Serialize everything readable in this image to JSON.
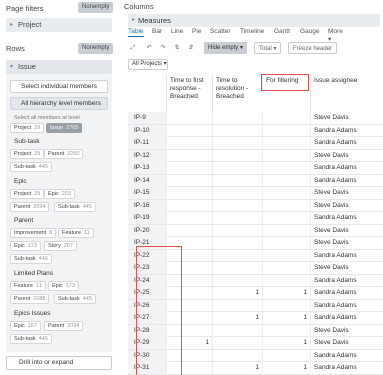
{
  "page_filters": {
    "label": "Page filters",
    "pill": "Nonempty",
    "dimension": "Project"
  },
  "rows_section": {
    "label": "Rows",
    "pill": "Nonempty",
    "dimension": "Issue"
  },
  "issue_panel": {
    "select_individual": "Select individual members",
    "all_hierarchy": "All hierarchy level members",
    "select_all_note": "Select all members at level",
    "top_chips": [
      {
        "label": "Project",
        "n": "29",
        "on": false
      },
      {
        "label": "Issue",
        "n": "2705",
        "on": true
      }
    ],
    "groups": [
      {
        "title": "Sub-task",
        "chips": [
          {
            "label": "Project",
            "n": "29"
          },
          {
            "label": "Parent",
            "n": "2260"
          },
          {
            "label": "Sub-task",
            "n": "445"
          }
        ]
      },
      {
        "title": "Epic",
        "chips": [
          {
            "label": "Project",
            "n": "29"
          },
          {
            "label": "Epic",
            "n": "203"
          },
          {
            "label": "Parent",
            "n": "2094"
          },
          {
            "label": "Sub-task",
            "n": "445"
          }
        ]
      },
      {
        "title": "Parent",
        "chips": [
          {
            "label": "Improvement",
            "n": "8"
          },
          {
            "label": "Feature",
            "n": "11"
          },
          {
            "label": "Epic",
            "n": "173"
          },
          {
            "label": "Story",
            "n": "207"
          },
          {
            "label": "Sub-task",
            "n": "446"
          }
        ]
      },
      {
        "title": "Limited Plans",
        "chips": [
          {
            "label": "Feature",
            "n": "11"
          },
          {
            "label": "Epic",
            "n": "173"
          },
          {
            "label": "Parent",
            "n": "2088"
          },
          {
            "label": "Sub-task",
            "n": "445"
          }
        ]
      },
      {
        "title": "Epics Issues",
        "chips": [
          {
            "label": "Epic",
            "n": "167"
          },
          {
            "label": "Parent",
            "n": "2094"
          },
          {
            "label": "Sub-task",
            "n": "445"
          }
        ]
      }
    ],
    "drill": "Drill into or expand"
  },
  "columns": {
    "label": "Columns",
    "dimension": "Measures"
  },
  "tabs": [
    "Table",
    "Bar",
    "Line",
    "Pie",
    "Scatter",
    "Timeline",
    "Gantt",
    "Gauge",
    "More"
  ],
  "selected_tab": "Table",
  "toolbar": {
    "hide_empty": "Hide empty",
    "total": "Total",
    "freeze": "Freeze header"
  },
  "project_filter": "All Projects",
  "table": {
    "headers": [
      "Time to first response - Breached",
      "Time to resolution - Breached",
      "For filtering",
      "Issue assignee"
    ],
    "rows": [
      {
        "key": "IP-9",
        "c1": "",
        "c2": "",
        "c3": "",
        "assignee": "Steve Davis"
      },
      {
        "key": "IP-10",
        "c1": "",
        "c2": "",
        "c3": "",
        "assignee": "Sandra Adams"
      },
      {
        "key": "IP-11",
        "c1": "",
        "c2": "",
        "c3": "",
        "assignee": "Sandra Adams"
      },
      {
        "key": "IP-12",
        "c1": "",
        "c2": "",
        "c3": "",
        "assignee": "Steve Davis"
      },
      {
        "key": "IP-13",
        "c1": "",
        "c2": "",
        "c3": "",
        "assignee": "Sandra Adams"
      },
      {
        "key": "IP-14",
        "c1": "",
        "c2": "",
        "c3": "",
        "assignee": "Sandra Adams"
      },
      {
        "key": "IP-15",
        "c1": "",
        "c2": "",
        "c3": "",
        "assignee": "Steve Davis"
      },
      {
        "key": "IP-16",
        "c1": "",
        "c2": "",
        "c3": "",
        "assignee": "Steve Davis"
      },
      {
        "key": "IP-19",
        "c1": "",
        "c2": "",
        "c3": "",
        "assignee": "Sandra Adams"
      },
      {
        "key": "IP-20",
        "c1": "",
        "c2": "",
        "c3": "",
        "assignee": "Steve Davis"
      },
      {
        "key": "IP-21",
        "c1": "",
        "c2": "",
        "c3": "",
        "assignee": "Steve Davis"
      },
      {
        "key": "IP-22",
        "c1": "",
        "c2": "",
        "c3": "",
        "assignee": "Sandra Adams"
      },
      {
        "key": "IP-23",
        "c1": "",
        "c2": "",
        "c3": "",
        "assignee": "Steve Davis"
      },
      {
        "key": "IP-24",
        "c1": "",
        "c2": "",
        "c3": "",
        "assignee": "Sandra Adams"
      },
      {
        "key": "IP-25",
        "c1": "",
        "c2": "1",
        "c3": "1",
        "assignee": "Sandra Adams"
      },
      {
        "key": "IP-26",
        "c1": "",
        "c2": "",
        "c3": "",
        "assignee": "Sandra Adams"
      },
      {
        "key": "IP-27",
        "c1": "",
        "c2": "1",
        "c3": "1",
        "assignee": "Sandra Adams"
      },
      {
        "key": "IP-28",
        "c1": "",
        "c2": "",
        "c3": "",
        "assignee": "Steve Davis"
      },
      {
        "key": "IP-29",
        "c1": "1",
        "c2": "",
        "c3": "1",
        "assignee": "Steve Davis"
      },
      {
        "key": "IP-30",
        "c1": "",
        "c2": "",
        "c3": "",
        "assignee": "Sandra Adams"
      },
      {
        "key": "IP-31",
        "c1": "",
        "c2": "1",
        "c3": "1",
        "assignee": "Sandra Adams"
      }
    ]
  }
}
